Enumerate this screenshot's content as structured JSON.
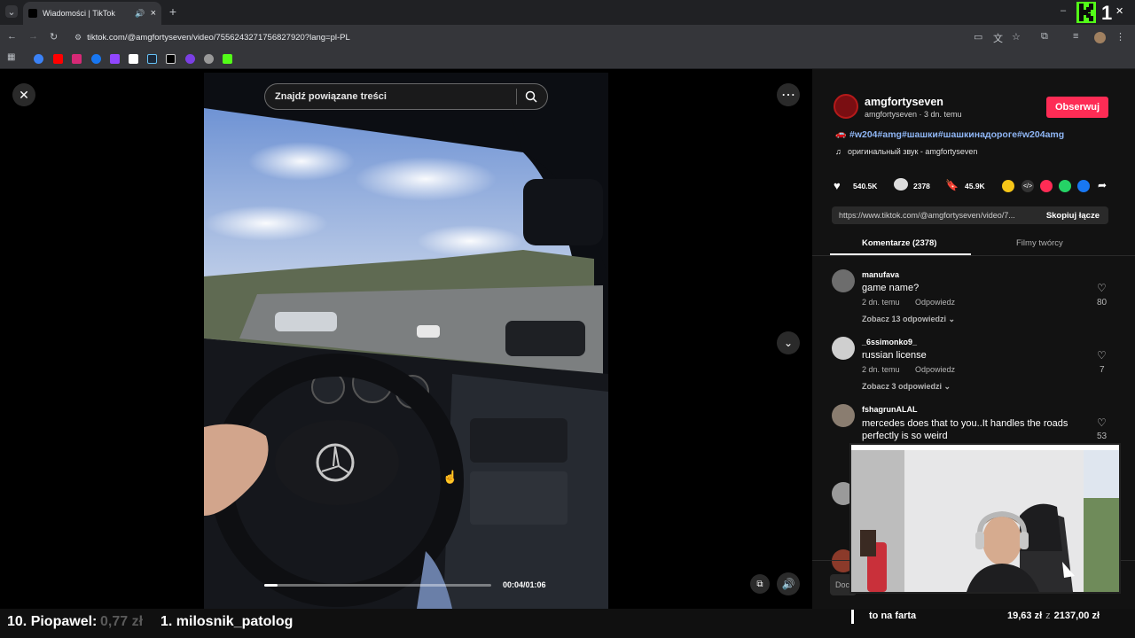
{
  "browser": {
    "tab_title": "Wiadomości | TikTok",
    "url": "tiktok.com/@amgfortyseven/video/7556243271756827920?lang=pl-PL"
  },
  "search": {
    "placeholder": "Znajdź powiązane treści"
  },
  "video": {
    "time": "00:04/01:06",
    "progress": 0.06
  },
  "author": {
    "name": "amgfortyseven",
    "meta": "amgfortyseven · 3 dn. temu",
    "follow_label": "Obserwuj",
    "hashtags": "#w204#amg#шашки#шашкинадороге#w204amg",
    "sound": "оригинальный звук - amgfortyseven"
  },
  "stats": {
    "likes": "540.5K",
    "comments": "2378",
    "saves": "45.9K"
  },
  "share": {
    "link": "https://www.tiktok.com/@amgfortyseven/video/7...",
    "copy_label": "Skopiuj łącze"
  },
  "tabs": {
    "comments": "Komentarze (2378)",
    "creator": "Filmy twórcy"
  },
  "comments": [
    {
      "user": "manufava",
      "text": "game name?",
      "time": "2 dn. temu",
      "reply": "Odpowiedz",
      "more": "Zobacz 13 odpowiedzi",
      "likes": "80"
    },
    {
      "user": "_6ssimonko9_",
      "text": "russian license",
      "time": "2 dn. temu",
      "reply": "Odpowiedz",
      "more": "Zobacz 3 odpowiedzi",
      "likes": "7"
    },
    {
      "user": "fshagrunALAL",
      "text": "mercedes does that to you..It handles the roads perfectly is so weird",
      "likes": "53"
    }
  ],
  "partial_input": "Doc",
  "stream_bar": {
    "donor1": "10. Piopawel:",
    "donor1_amount": "0,77 zł",
    "donor2": "1. milosnik_patolog",
    "goal_text": "to na farta",
    "goal_amount": "19,63 zł",
    "goal_sep": "z",
    "goal_total": "2137,00 zł"
  },
  "overlay": {
    "logo_number": "1"
  },
  "colors": {
    "accent": "#fe2c55",
    "link": "#8fb6f5"
  }
}
